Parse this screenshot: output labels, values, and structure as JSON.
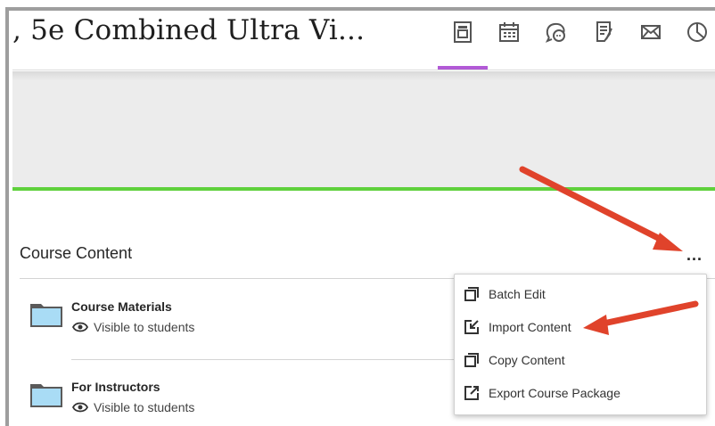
{
  "header": {
    "course_title": ", 5e Combined Ultra Vi...",
    "nav_icons": [
      "content-icon",
      "calendar-icon",
      "discussions-icon",
      "gradebook-icon",
      "messages-icon",
      "analytics-icon"
    ],
    "active_accent": "#b25ad6"
  },
  "banner": {
    "accent_color": "#5fd13c"
  },
  "course_content": {
    "title": "Course Content",
    "more_label": "...",
    "items": [
      {
        "title": "Course Materials",
        "visibility": "Visible to students",
        "icon": "folder-icon"
      },
      {
        "title": "For Instructors",
        "visibility": "Visible to students",
        "icon": "folder-icon"
      }
    ]
  },
  "menu": {
    "items": [
      {
        "label": "Batch Edit",
        "icon": "batch-edit-icon"
      },
      {
        "label": "Import Content",
        "icon": "import-icon"
      },
      {
        "label": "Copy Content",
        "icon": "copy-icon"
      },
      {
        "label": "Export Course Package",
        "icon": "export-icon"
      }
    ]
  },
  "annotations": {
    "arrow_color": "#e0432b"
  }
}
